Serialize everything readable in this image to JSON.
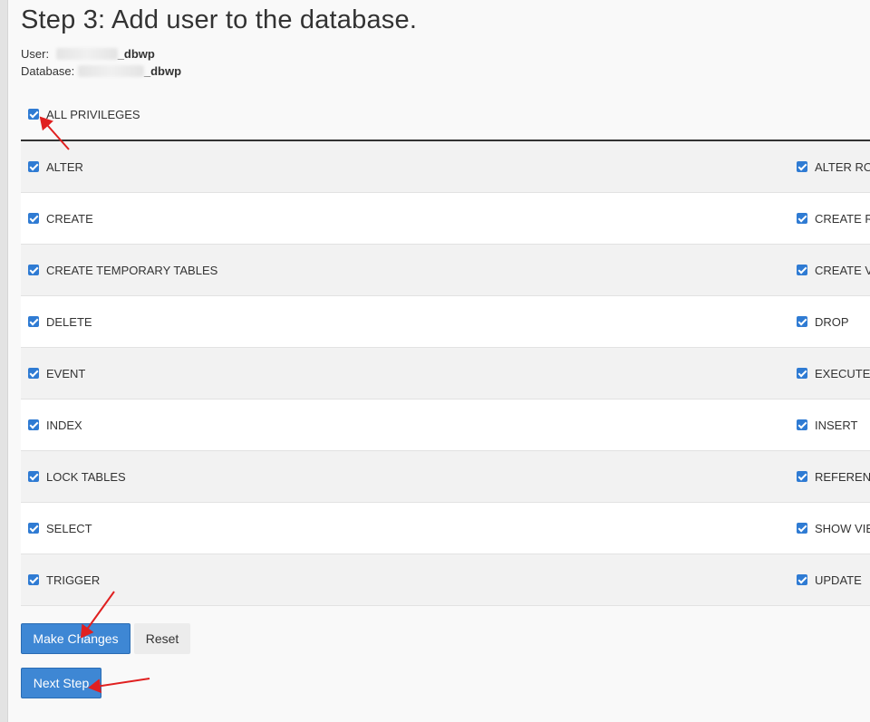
{
  "page": {
    "title": "Step 3: Add user to the database.",
    "user_label": "User:",
    "user_value": "_dbwp",
    "database_label": "Database:",
    "database_value": "_dbwp"
  },
  "all_privileges": {
    "label": "ALL PRIVILEGES",
    "checked": true
  },
  "privileges": [
    {
      "left": "ALTER",
      "right": "ALTER RO"
    },
    {
      "left": "CREATE",
      "right": "CREATE R"
    },
    {
      "left": "CREATE TEMPORARY TABLES",
      "right": "CREATE V"
    },
    {
      "left": "DELETE",
      "right": "DROP"
    },
    {
      "left": "EVENT",
      "right": "EXECUTE"
    },
    {
      "left": "INDEX",
      "right": "INSERT"
    },
    {
      "left": "LOCK TABLES",
      "right": "REFERENC"
    },
    {
      "left": "SELECT",
      "right": "SHOW VIE"
    },
    {
      "left": "TRIGGER",
      "right": "UPDATE"
    }
  ],
  "buttons": {
    "make_changes": "Make Changes",
    "reset": "Reset",
    "next_step": "Next Step"
  },
  "colors": {
    "primary": "#3e87d4",
    "checkbox": "#2f7bd3",
    "annotation_arrow": "#e02020"
  },
  "icons": {
    "checkbox": "checkbox-checked-icon",
    "annotation": "red-arrow-icon"
  }
}
